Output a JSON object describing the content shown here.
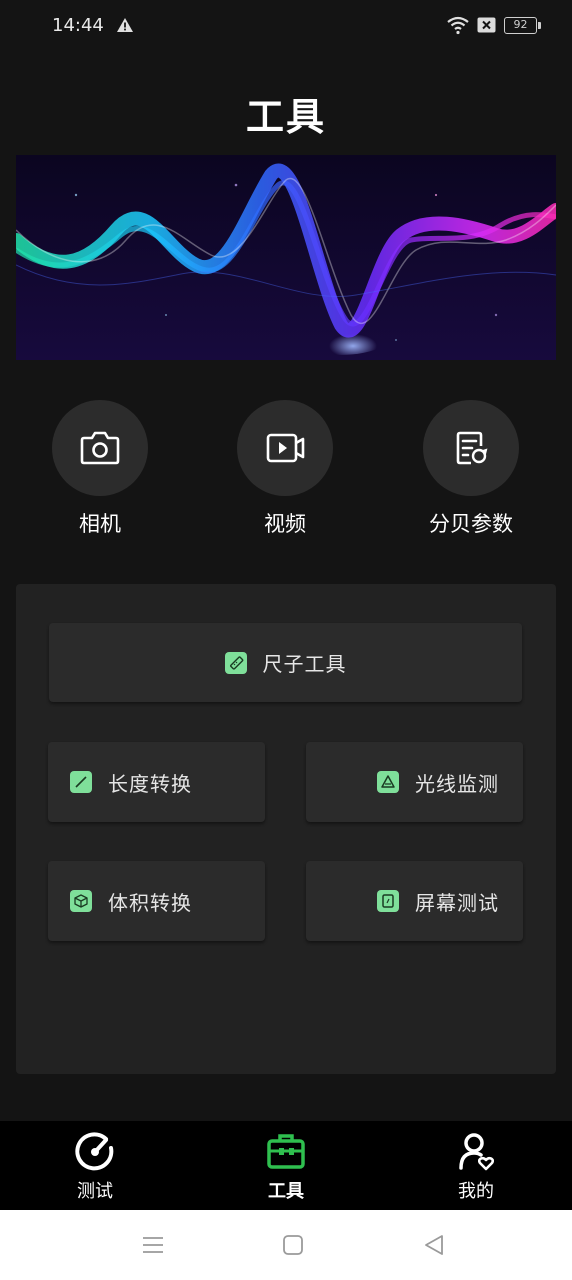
{
  "status_bar": {
    "time": "14:44",
    "battery": "92"
  },
  "header": {
    "title": "工具"
  },
  "round_tools": [
    {
      "label": "相机",
      "icon": "camera-icon"
    },
    {
      "label": "视频",
      "icon": "video-icon"
    },
    {
      "label": "分贝参数",
      "icon": "decibel-icon"
    }
  ],
  "tools": {
    "ruler": "尺子工具",
    "length": "长度转换",
    "light": "光线监测",
    "volume": "体积转换",
    "screen": "屏幕测试"
  },
  "bottom_nav": [
    {
      "label": "测试",
      "icon": "gauge-icon"
    },
    {
      "label": "工具",
      "icon": "toolbox-icon",
      "active": true
    },
    {
      "label": "我的",
      "icon": "profile-icon"
    }
  ],
  "colors": {
    "accent": "#7fdf9a",
    "active_nav": "#2fbf4f",
    "background": "#141414",
    "panel": "#222222"
  }
}
